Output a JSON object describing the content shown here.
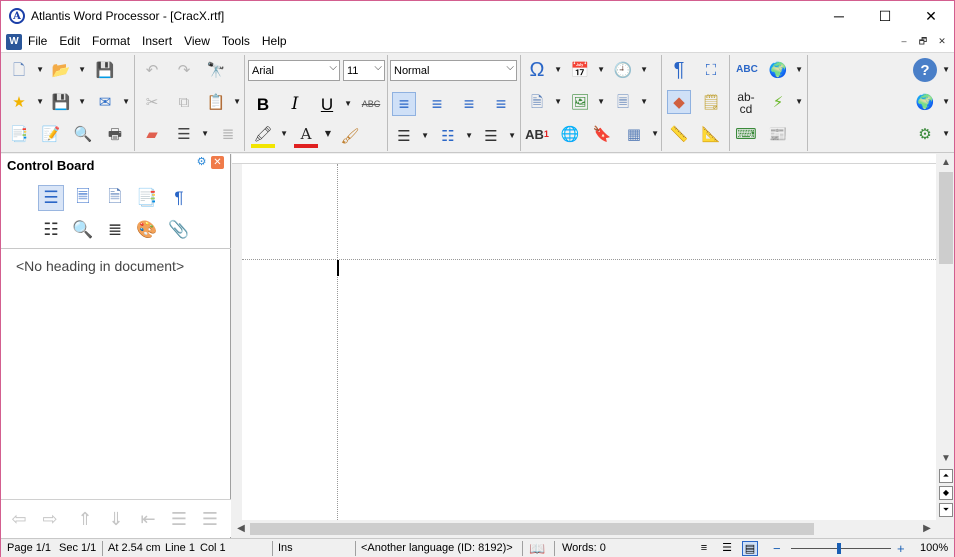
{
  "window": {
    "title": "Atlantis Word Processor - [CracX.rtf]",
    "app_icon_letter": "A",
    "controls": {
      "minimize": "─",
      "maximize": "☐",
      "close": "✕"
    }
  },
  "menu": {
    "doc_icon_letter": "W",
    "items": [
      "File",
      "Edit",
      "Format",
      "Insert",
      "View",
      "Tools",
      "Help"
    ],
    "mdi": {
      "minimize": "–",
      "restore": "🗗",
      "close": "✕"
    }
  },
  "toolbar": {
    "font_name": "Arial",
    "font_size": "11",
    "style": "Normal",
    "bold": "B",
    "italic": "I",
    "underline": "U",
    "strikethrough": "ABC",
    "superscript_label": "AB",
    "superscript_digit": "1",
    "spellcheck_label": "ABC",
    "replace_top": "ab-",
    "replace_bottom": "cd",
    "glyphs": {
      "new": "🗋",
      "open": "📂",
      "save": "💾",
      "undo": "↶",
      "redo": "↷",
      "find": "🔭",
      "favorite": "★",
      "save-as": "💾",
      "email": "✉",
      "cut": "✂",
      "copy": "⧉",
      "paste": "📋",
      "properties": "📑",
      "edit": "📝",
      "print-preview": "🔍",
      "print": "🖶",
      "eraser": "▰",
      "paragraph-lines": "☰",
      "columns": "≣",
      "highlight": "🖍",
      "font-color": "A",
      "format-painter": "🖌",
      "align-left": "≡",
      "align-center": "≡",
      "align-right": "≡",
      "justify": "≡",
      "bullets": "☰",
      "numbering": "☷",
      "multilevel": "☰",
      "symbol": "Ω",
      "date": "📅",
      "clock": "🕘",
      "page-break": "🗎",
      "picture": "🖼",
      "header-footer": "🗏",
      "hyperlink": "🌐",
      "bookmark": "🔖",
      "table": "▦",
      "pilcrow": "¶",
      "fullscreen": "⛶",
      "pane": "◆",
      "outline": "🗒",
      "ruler": "📏",
      "vruler": "📐",
      "autocorrect": "🌍",
      "lightning": "⚡",
      "speak": "⌨",
      "plugin": "📰",
      "help": "?",
      "web": "🌍",
      "settings": "⚙"
    }
  },
  "control_board": {
    "title": "Control Board",
    "gear": "⚙",
    "close": "✕",
    "empty_message": "<No heading in document>",
    "icons": {
      "headings": "☰",
      "styles": "🗏",
      "notes": "🗎",
      "bookmarks": "📑",
      "fonts": "¶",
      "outline": "☷",
      "find": "🔍",
      "list": "≣",
      "palette": "🎨",
      "clips": "📎"
    },
    "nav": {
      "back": "⇦",
      "forward": "⇨",
      "move-up": "⇑",
      "move-down": "⇓",
      "promote": "⇤",
      "collapse": "☰",
      "expand": "☰"
    }
  },
  "statusbar": {
    "page": "Page 1/1",
    "section": "Sec 1/1",
    "position": "At 2.54 cm",
    "line": "Line 1",
    "col": "Col 1",
    "mode": "Ins",
    "language": "<Another language (ID: 8192)>",
    "book_icon": "📖",
    "words": "Words: 0",
    "zoom_minus": "−",
    "zoom_plus": "+",
    "zoom": "100%",
    "zoom_level_percent": 100,
    "views": {
      "draft": "≡",
      "normal": "☰",
      "page": "▤"
    }
  },
  "scrollbars": {
    "up": "▲",
    "down": "▼",
    "left": "◀",
    "right": "▶",
    "prev_page": "⏶",
    "browse": "◆",
    "next_page": "⏷"
  },
  "colors": {
    "window_border": "#d35e8f",
    "highlight_yellow": "#f2e500",
    "font_color_red": "#e02020",
    "accent_blue": "#2a66c7"
  }
}
